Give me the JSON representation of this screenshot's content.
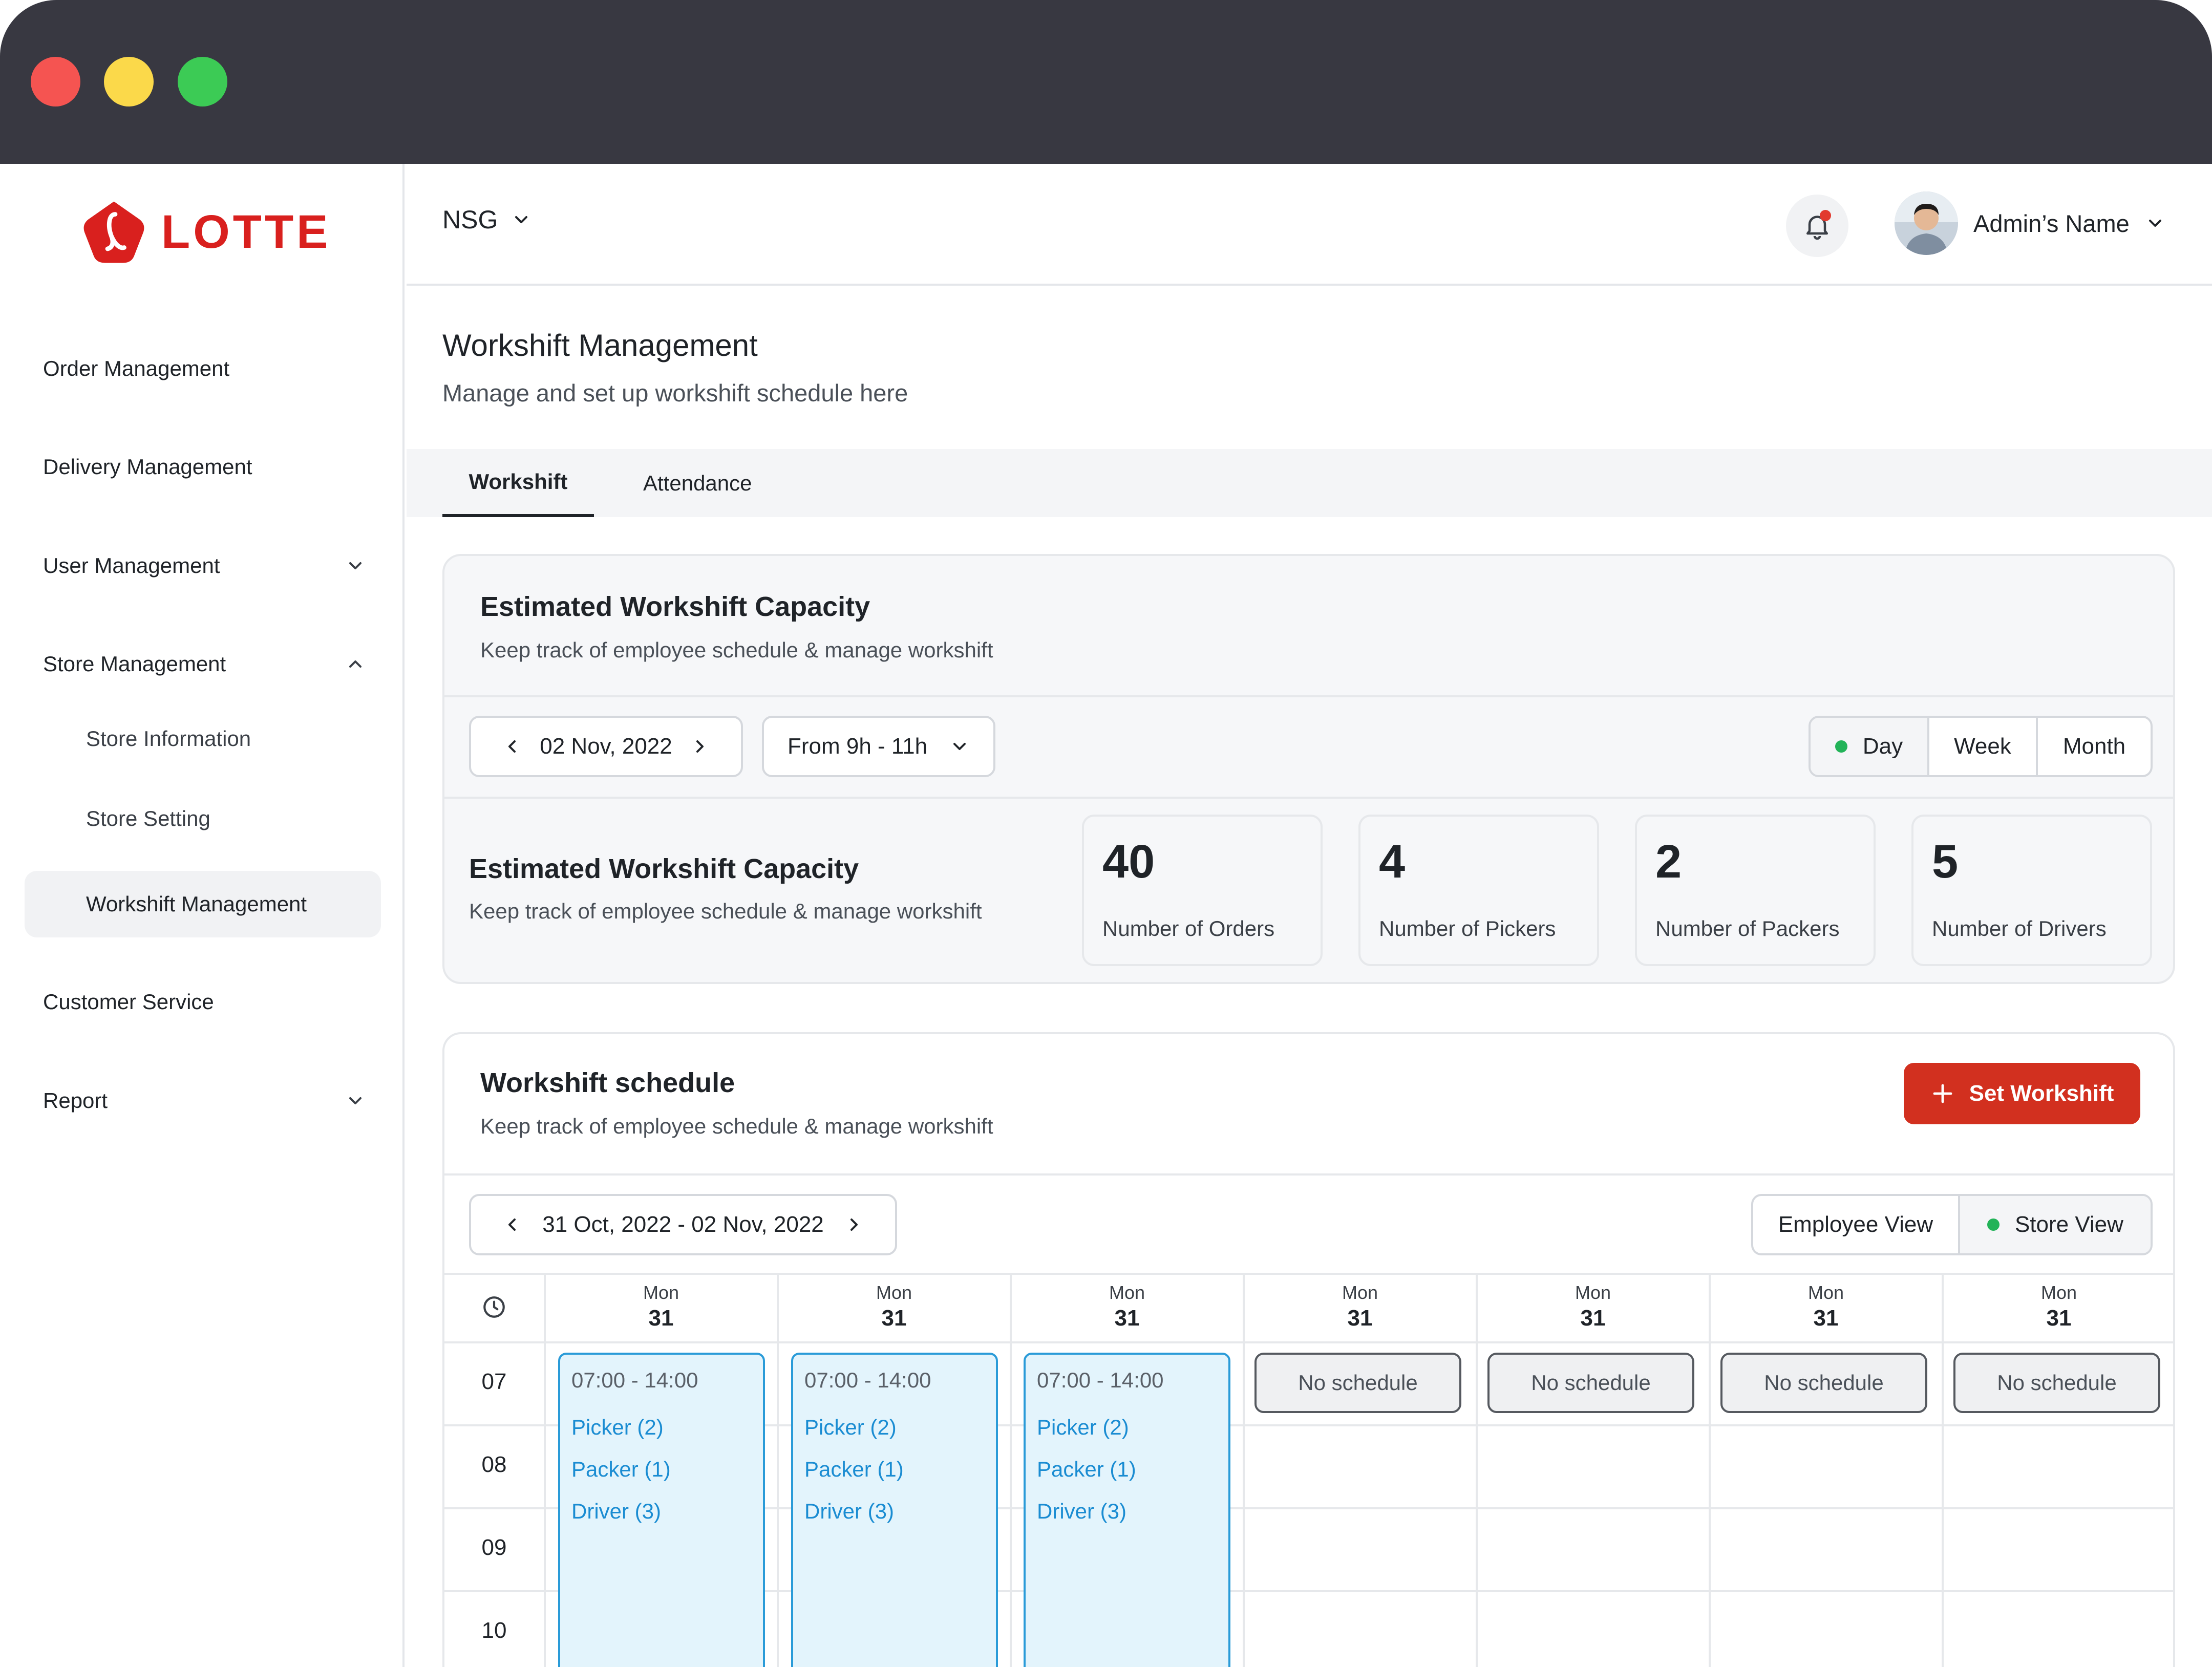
{
  "brand": {
    "name": "LOTTE",
    "color": "#d9201e"
  },
  "sidebar": {
    "items": [
      {
        "label": "Order Management"
      },
      {
        "label": "Delivery Management"
      },
      {
        "label": "User Management"
      },
      {
        "label": "Store Management"
      },
      {
        "label": "Store Information"
      },
      {
        "label": "Store Setting"
      },
      {
        "label": "Workshift Management"
      },
      {
        "label": "Customer Service"
      },
      {
        "label": "Report"
      }
    ],
    "active": "Workshift Management"
  },
  "header": {
    "store": "NSG",
    "admin_name": "Admin’s Name",
    "icons": [
      "chevron-down-icon",
      "bell-icon",
      "avatar"
    ]
  },
  "page": {
    "title": "Workshift Management",
    "subtitle": "Manage and set up workshift schedule here"
  },
  "tabs": [
    {
      "label": "Workshift",
      "active": true
    },
    {
      "label": "Attendance",
      "active": false
    }
  ],
  "capacity": {
    "title": "Estimated Workshift Capacity",
    "subtitle": "Keep track of employee schedule & manage workshift",
    "date": "02 Nov, 2022",
    "time_range": "From 9h - 11h",
    "views": [
      "Day",
      "Week",
      "Month"
    ],
    "active_view": "Day",
    "summary_title": "Estimated Workshift Capacity",
    "summary_subtitle": "Keep track of employee schedule & manage workshift",
    "stats": [
      {
        "value": "40",
        "label": "Number of Orders"
      },
      {
        "value": "4",
        "label": "Number of Pickers"
      },
      {
        "value": "2",
        "label": "Number of Packers"
      },
      {
        "value": "5",
        "label": "Number of Drivers"
      }
    ]
  },
  "schedule": {
    "title": "Workshift schedule",
    "subtitle": "Keep track of employee schedule & manage workshift",
    "set_button": "Set Workshift",
    "date_range": "31 Oct, 2022 - 02 Nov, 2022",
    "views": [
      "Employee View",
      "Store View"
    ],
    "active_view": "Store View",
    "days": [
      {
        "name": "Mon",
        "num": "31"
      },
      {
        "name": "Mon",
        "num": "31"
      },
      {
        "name": "Mon",
        "num": "31"
      },
      {
        "name": "Mon",
        "num": "31"
      },
      {
        "name": "Mon",
        "num": "31"
      },
      {
        "name": "Mon",
        "num": "31"
      },
      {
        "name": "Mon",
        "num": "31"
      }
    ],
    "hours": [
      "07",
      "08",
      "09",
      "10"
    ],
    "shifts": [
      {
        "time": "07:00 - 14:00",
        "roles": [
          "Picker (2)",
          "Packer (1)",
          "Driver (3)"
        ]
      },
      {
        "time": "07:00 - 14:00",
        "roles": [
          "Picker (2)",
          "Packer (1)",
          "Driver (3)"
        ]
      },
      {
        "time": "07:00 - 14:00",
        "roles": [
          "Picker (2)",
          "Packer (1)",
          "Driver (3)"
        ]
      }
    ],
    "no_schedule_label": "No schedule"
  },
  "colors": {
    "titlebar": "#383841",
    "primary": "#d2301f",
    "shift_bg": "#e3f4fc",
    "shift_border": "#2a9bd8",
    "active_dot": "#22b358"
  }
}
